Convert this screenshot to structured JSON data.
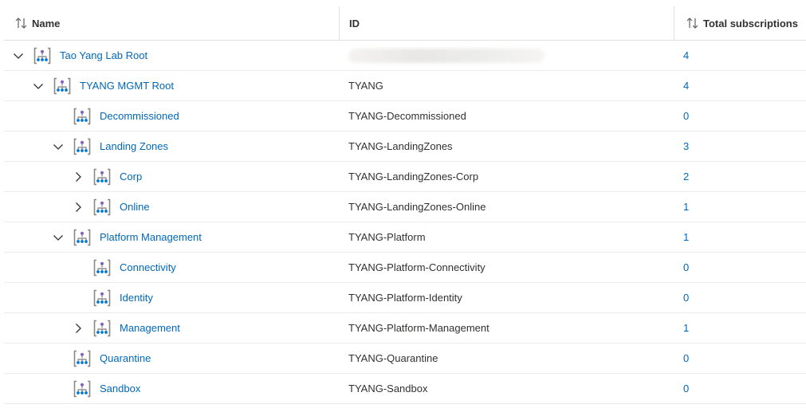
{
  "columns": {
    "name": "Name",
    "id": "ID",
    "subscriptions": "Total subscriptions"
  },
  "colors": {
    "link": "#0067b8",
    "border": "#e1dfdd",
    "icon_bracket": "#8a8886",
    "icon_top": "#8661c5",
    "icon_nodes": "#0078d4"
  },
  "rows": [
    {
      "name": "Tao Yang Lab Root",
      "id": "",
      "id_redacted": true,
      "subs": "4",
      "level": 0,
      "chevron": "expanded"
    },
    {
      "name": "TYANG MGMT Root",
      "id": "TYANG",
      "subs": "4",
      "level": 1,
      "chevron": "expanded"
    },
    {
      "name": "Decommissioned",
      "id": "TYANG-Decommissioned",
      "subs": "0",
      "level": 2,
      "chevron": "none"
    },
    {
      "name": "Landing Zones",
      "id": "TYANG-LandingZones",
      "subs": "3",
      "level": 2,
      "chevron": "expanded"
    },
    {
      "name": "Corp",
      "id": "TYANG-LandingZones-Corp",
      "subs": "2",
      "level": 3,
      "chevron": "collapsed"
    },
    {
      "name": "Online",
      "id": "TYANG-LandingZones-Online",
      "subs": "1",
      "level": 3,
      "chevron": "collapsed"
    },
    {
      "name": "Platform Management",
      "id": "TYANG-Platform",
      "subs": "1",
      "level": 2,
      "chevron": "expanded"
    },
    {
      "name": "Connectivity",
      "id": "TYANG-Platform-Connectivity",
      "subs": "0",
      "level": 3,
      "chevron": "none"
    },
    {
      "name": "Identity",
      "id": "TYANG-Platform-Identity",
      "subs": "0",
      "level": 3,
      "chevron": "none"
    },
    {
      "name": "Management",
      "id": "TYANG-Platform-Management",
      "subs": "1",
      "level": 3,
      "chevron": "collapsed"
    },
    {
      "name": "Quarantine",
      "id": "TYANG-Quarantine",
      "subs": "0",
      "level": 2,
      "chevron": "none"
    },
    {
      "name": "Sandbox",
      "id": "TYANG-Sandbox",
      "subs": "0",
      "level": 2,
      "chevron": "none"
    }
  ]
}
